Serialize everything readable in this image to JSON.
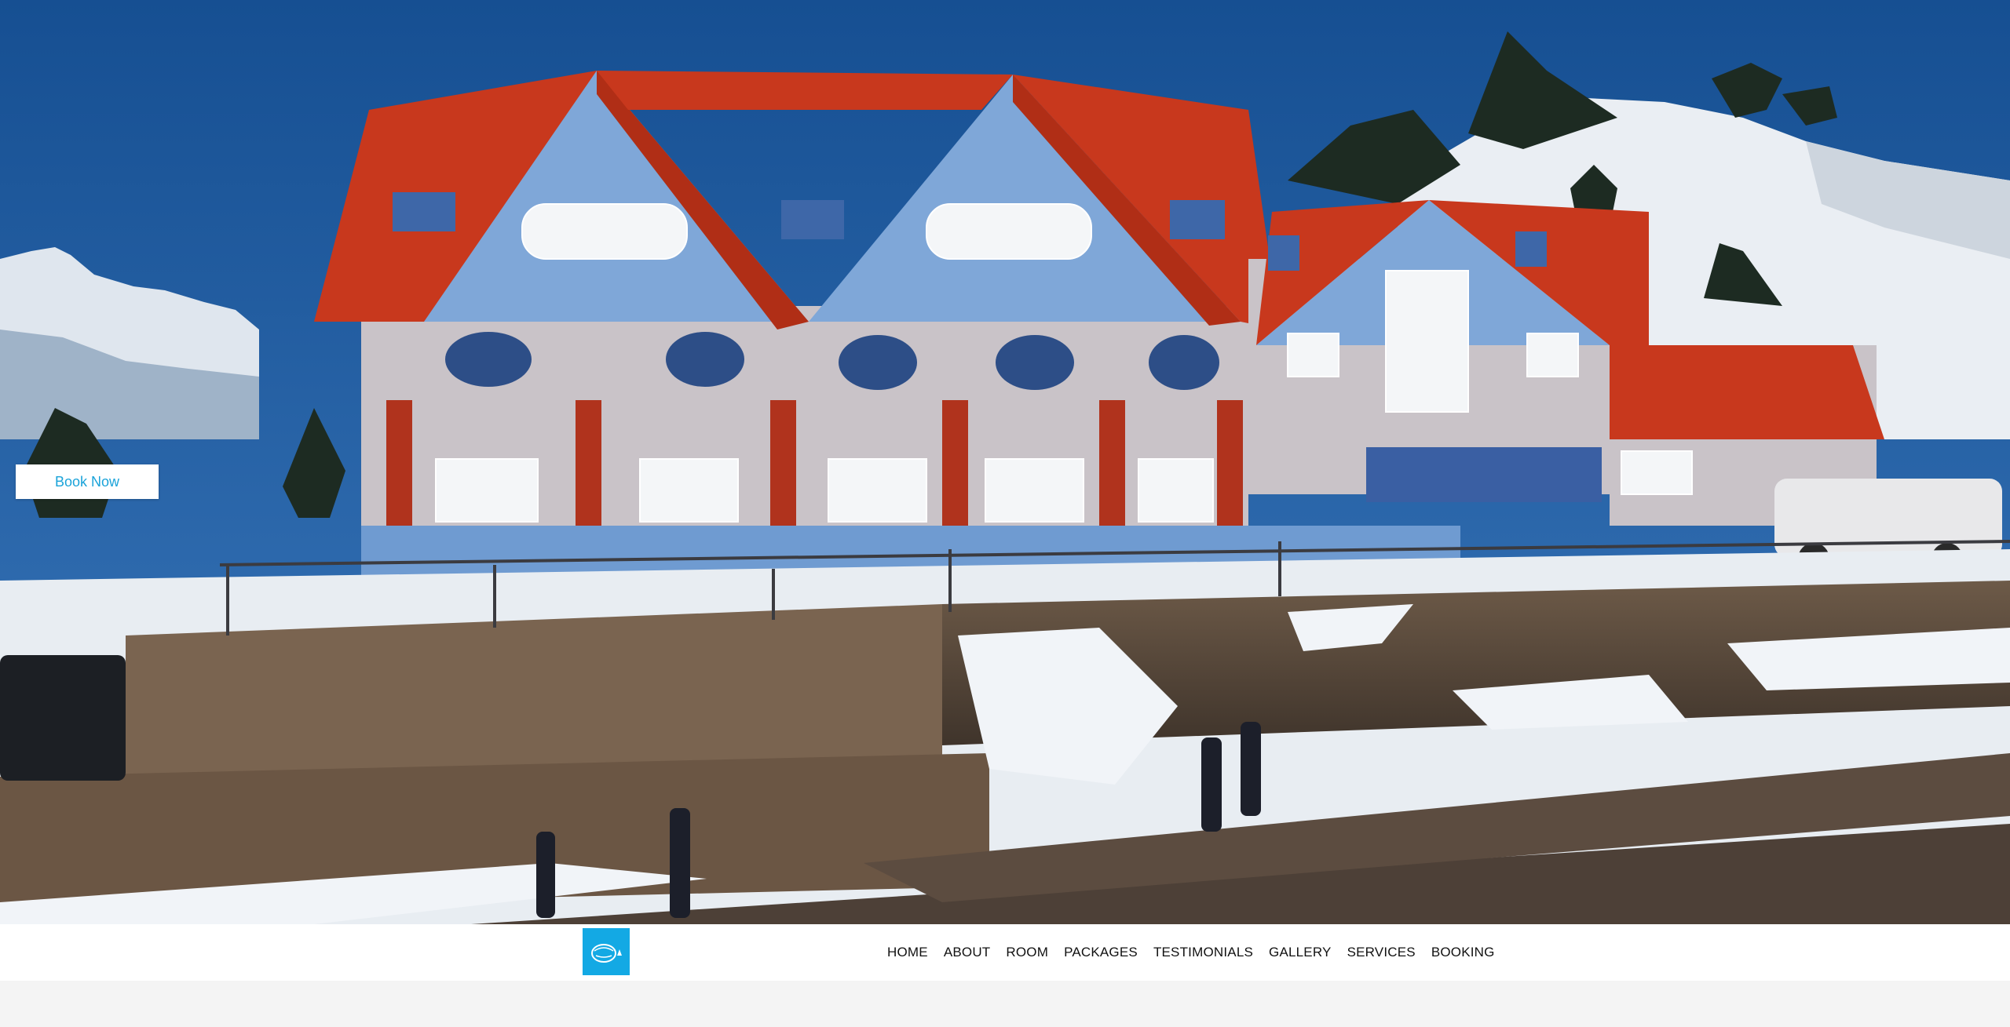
{
  "hero": {
    "book_now_label": "Book Now",
    "colors": {
      "sky": "#1d5aa0",
      "roof": "#c8381d",
      "wall": "#c9c3c8",
      "snow": "#eef2f6"
    }
  },
  "navbar": {
    "logo_icon": "resort-logo-icon",
    "items": [
      "HOME",
      "ABOUT",
      "ROOM",
      "PACKAGES",
      "TESTIMONIALS",
      "GALLERY",
      "SERVICES",
      "BOOKING"
    ],
    "accent": "#13a9e4"
  }
}
